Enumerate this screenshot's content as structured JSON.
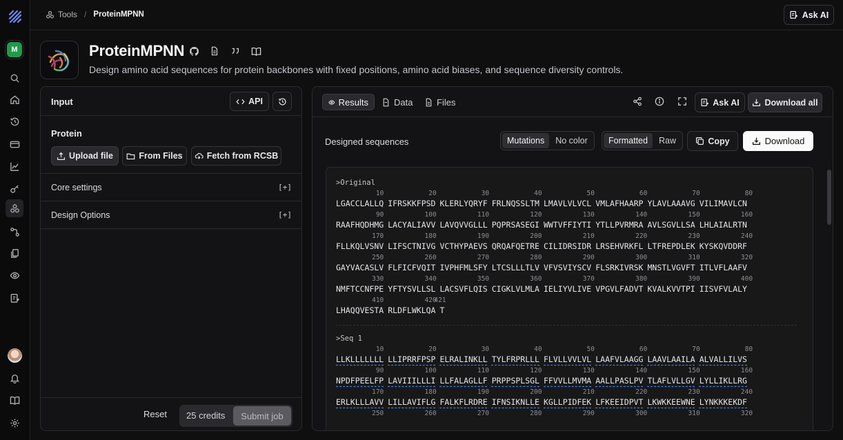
{
  "breadcrumb": {
    "tools": "Tools",
    "current": "ProteinMPNN"
  },
  "top": {
    "ask_ai": "Ask AI"
  },
  "rail": {
    "workspace_initial": "M"
  },
  "header": {
    "title": "ProteinMPNN",
    "description": "Design amino acid sequences for protein backbones with fixed positions, amino acid biases, and sequence diversity controls."
  },
  "input_panel": {
    "title": "Input",
    "api_label": "API",
    "protein_label": "Protein",
    "upload_label": "Upload file",
    "from_files_label": "From Files",
    "fetch_label": "Fetch from RCSB",
    "core_settings": "Core settings",
    "design_options": "Design Options",
    "expand_glyph": "[+]",
    "reset_label": "Reset",
    "credits_label": "25 credits",
    "submit_label": "Submit job"
  },
  "results_panel": {
    "tabs": [
      "Results",
      "Data",
      "Files"
    ],
    "ask_ai": "Ask AI",
    "download_all": "Download all",
    "designed_sequences": "Designed sequences",
    "mode_mutations": "Mutations",
    "mode_nocolor": "No color",
    "fmt_formatted": "Formatted",
    "fmt_raw": "Raw",
    "copy_label": "Copy",
    "download_label": "Download"
  },
  "sequences": {
    "original_name": ">Original",
    "original_rows": [
      {
        "nums": [
          "10",
          "20",
          "30",
          "40",
          "50",
          "60",
          "70",
          "80"
        ],
        "blocks": [
          "LGACCLALLQ",
          "IFRSKKFPSD",
          "KLERLYQRYF",
          "FRLNQSSLTM",
          "LMAVLVLVCL",
          "VMLAFHAARP",
          "YLAVLAAAVG",
          "VILIMAVLCN"
        ]
      },
      {
        "nums": [
          "90",
          "100",
          "110",
          "120",
          "130",
          "140",
          "150",
          "160"
        ],
        "blocks": [
          "RAAFHQDHMG",
          "LACYALIAVV",
          "LAVQVVGLLL",
          "PQPRSASEGI",
          "WWTVFFIYTI",
          "YTLLPVRMRA",
          "AVLSGVLLSA",
          "LHLAIALRTN"
        ]
      },
      {
        "nums": [
          "170",
          "180",
          "190",
          "200",
          "210",
          "220",
          "230",
          "240"
        ],
        "blocks": [
          "FLLKQLVSNV",
          "LIFSCTNIVG",
          "VCTHYPAEVS",
          "QRQAFQETRE",
          "CILIDRSIDR",
          "LRSEHVRKFL",
          "LTFREPDLEK",
          "KYSKQVDDRF"
        ]
      },
      {
        "nums": [
          "250",
          "260",
          "270",
          "280",
          "290",
          "300",
          "310",
          "320"
        ],
        "blocks": [
          "GAYVACASLV",
          "FLFICFVQIT",
          "IVPHFMLSFY",
          "LTCSLLLTLV",
          "VFVSVIYSCV",
          "FLSRKIVRSK",
          "MNSTLVGVFT",
          "ITLVFLAAFV"
        ]
      },
      {
        "nums": [
          "330",
          "340",
          "350",
          "360",
          "370",
          "380",
          "390",
          "400"
        ],
        "blocks": [
          "NMFTCCNFPE",
          "YFTYSVLLSL",
          "LACSVFLQIS",
          "CIGKLVLMLA",
          "IELIYVLIVE",
          "VPGVLFADVT",
          "KVALKVVTPI",
          "IISVFVLALY"
        ]
      },
      {
        "nums": [
          "410",
          "420",
          "421"
        ],
        "blocks": [
          "LHAQQVESTA",
          "RLDFLWKLQA",
          "T"
        ]
      }
    ],
    "seq1_name": ">Seq 1",
    "seq1_rows": [
      {
        "nums": [
          "10",
          "20",
          "30",
          "40",
          "50",
          "60",
          "70",
          "80"
        ],
        "blocks": [
          "LLKLLLLLLL",
          "LLIPRRFPSP",
          "ELRALINKLL",
          "TYLFRPRLLL",
          "FLVLLVVLVL",
          "LAAFVLAAGG",
          "LAAVLAAILA",
          "ALVALLILVS"
        ]
      },
      {
        "nums": [
          "90",
          "100",
          "110",
          "120",
          "130",
          "140",
          "150",
          "160"
        ],
        "blocks": [
          "NPDFPEELFP",
          "LAVIIILLLI",
          "LLFALAGLLF",
          "PRPPSPLSGL",
          "FFVVLLMVMA",
          "AALLPASLPV",
          "TLAFLVLLGV",
          "LYLLIKLLRG"
        ]
      },
      {
        "nums": [
          "170",
          "180",
          "190",
          "200",
          "210",
          "220",
          "230",
          "240"
        ],
        "blocks": [
          "ERLKLLLAVV",
          "LILLAVIFLG",
          "FALKFLRDRE",
          "IFNSIKNLLE",
          "KGLLPIDFEK",
          "LFKEEIDPVT",
          "LKWKKEEWNE",
          "LYNKKKEKDF"
        ]
      },
      {
        "nums": [
          "250",
          "260",
          "270",
          "280",
          "290",
          "300",
          "310",
          "320"
        ],
        "blocks": [
          "",
          "",
          "",
          "",
          "",
          "",
          "",
          ""
        ]
      }
    ]
  }
}
